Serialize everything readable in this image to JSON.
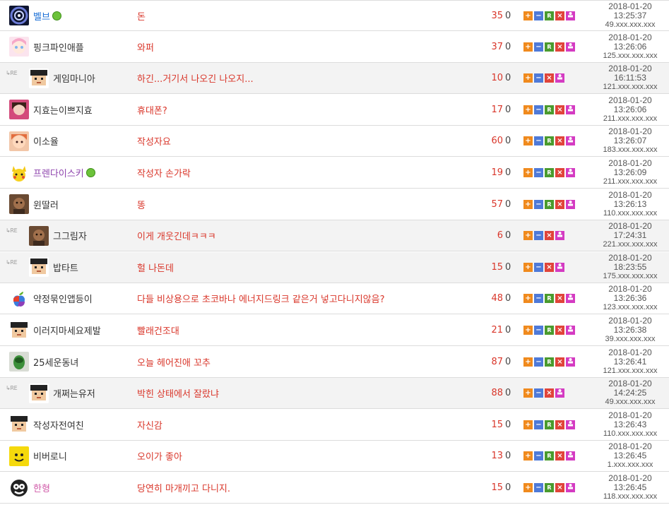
{
  "rows": [
    {
      "reply": false,
      "avatar": "vortex-avatar",
      "name": "벨브",
      "nameColor": "blue",
      "badge": true,
      "title": "돈",
      "score": "35",
      "dislike": "0",
      "date": "2018-01-20",
      "time": "13:25:37",
      "ip": "49.xxx.xxx.xxx"
    },
    {
      "reply": false,
      "avatar": "anime-girl-avatar",
      "name": "핑크파인애플",
      "nameColor": "",
      "badge": false,
      "title": "와퍼",
      "score": "37",
      "dislike": "0",
      "date": "2018-01-20",
      "time": "13:26:06",
      "ip": "125.xxx.xxx.xxx"
    },
    {
      "reply": true,
      "avatar": "pixel-man-avatar",
      "name": "게임마니아",
      "nameColor": "",
      "badge": false,
      "title": "하긴...거기서 나오긴 나오지...",
      "score": "10",
      "dislike": "0",
      "date": "2018-01-20",
      "time": "16:11:53",
      "ip": "121.xxx.xxx.xxx"
    },
    {
      "reply": false,
      "avatar": "girl-photo-avatar",
      "name": "지효는이쁘지효",
      "nameColor": "",
      "badge": false,
      "title": "휴대폰?",
      "score": "17",
      "dislike": "0",
      "date": "2018-01-20",
      "time": "13:26:06",
      "ip": "211.xxx.xxx.xxx"
    },
    {
      "reply": false,
      "avatar": "cartoon-face-avatar",
      "name": "이소율",
      "nameColor": "",
      "badge": false,
      "title": "작성자요",
      "score": "60",
      "dislike": "0",
      "date": "2018-01-20",
      "time": "13:26:07",
      "ip": "183.xxx.xxx.xxx"
    },
    {
      "reply": false,
      "avatar": "pikachu-avatar",
      "name": "프렌다이스키",
      "nameColor": "purple",
      "badge": true,
      "title": "작성자 손가락",
      "score": "19",
      "dislike": "0",
      "date": "2018-01-20",
      "time": "13:26:09",
      "ip": "211.xxx.xxx.xxx"
    },
    {
      "reply": false,
      "avatar": "man-photo-avatar",
      "name": "윈딸러",
      "nameColor": "",
      "badge": false,
      "title": "똥",
      "score": "57",
      "dislike": "0",
      "date": "2018-01-20",
      "time": "13:26:13",
      "ip": "110.xxx.xxx.xxx"
    },
    {
      "reply": true,
      "avatar": "man-photo-avatar",
      "name": "그그림자",
      "nameColor": "",
      "badge": false,
      "title": "이게 개웃긴데ㅋㅋㅋ",
      "score": "6",
      "dislike": "0",
      "date": "2018-01-20",
      "time": "17:24:31",
      "ip": "221.xxx.xxx.xxx"
    },
    {
      "reply": true,
      "avatar": "pixel-man-avatar",
      "name": "밥타트",
      "nameColor": "",
      "badge": false,
      "title": "헐 나돈데",
      "score": "15",
      "dislike": "0",
      "date": "2018-01-20",
      "time": "18:23:55",
      "ip": "175.xxx.xxx.xxx"
    },
    {
      "reply": false,
      "avatar": "apple-logo-avatar",
      "name": "약정묶인앱등이",
      "nameColor": "",
      "badge": false,
      "title": "다들 비상용으로 초코바나 에너지드링크 같은거 넣고다니지않음?",
      "score": "48",
      "dislike": "0",
      "date": "2018-01-20",
      "time": "13:26:36",
      "ip": "123.xxx.xxx.xxx"
    },
    {
      "reply": false,
      "avatar": "pixel-man-avatar",
      "name": "이러지마세요제발",
      "nameColor": "",
      "badge": false,
      "title": "빨래건조대",
      "score": "21",
      "dislike": "0",
      "date": "2018-01-20",
      "time": "13:26:38",
      "ip": "39.xxx.xxx.xxx"
    },
    {
      "reply": false,
      "avatar": "green-face-avatar",
      "name": "25세운동녀",
      "nameColor": "",
      "badge": false,
      "title": "오늘 헤어진애 꼬추",
      "score": "87",
      "dislike": "0",
      "date": "2018-01-20",
      "time": "13:26:41",
      "ip": "121.xxx.xxx.xxx"
    },
    {
      "reply": true,
      "avatar": "pixel-man-avatar",
      "name": "개쩌는유저",
      "nameColor": "",
      "badge": false,
      "title": "박힌 상태에서 잘랐냐",
      "score": "88",
      "dislike": "0",
      "date": "2018-01-20",
      "time": "14:24:25",
      "ip": "49.xxx.xxx.xxx"
    },
    {
      "reply": false,
      "avatar": "pixel-man-avatar",
      "name": "작성자전여친",
      "nameColor": "",
      "badge": false,
      "title": "자신감",
      "score": "15",
      "dislike": "0",
      "date": "2018-01-20",
      "time": "13:26:43",
      "ip": "110.xxx.xxx.xxx"
    },
    {
      "reply": false,
      "avatar": "yellow-face-avatar",
      "name": "비버로니",
      "nameColor": "",
      "badge": false,
      "title": "오이가 좋아",
      "score": "13",
      "dislike": "0",
      "date": "2018-01-20",
      "time": "13:26:45",
      "ip": "1.xxx.xxx.xxx"
    },
    {
      "reply": false,
      "avatar": "bw-logo-avatar",
      "name": "한형",
      "nameColor": "pink",
      "badge": false,
      "title": "당연히 마개끼고 다니지.",
      "score": "15",
      "dislike": "0",
      "date": "2018-01-20",
      "time": "13:26:45",
      "ip": "118.xxx.xxx.xxx"
    }
  ],
  "labels": {
    "reply_mark": "RE"
  },
  "buttons": {
    "plus": "+",
    "minus": "−",
    "report": "R",
    "delete": "×"
  },
  "colors": {
    "title": "#d9362a",
    "score": "#d9362a",
    "reply_bg": "#f3f3f3",
    "nick_blue": "#1a6fd6",
    "nick_purple": "#8e44ad",
    "nick_pink": "#d05aa8"
  }
}
